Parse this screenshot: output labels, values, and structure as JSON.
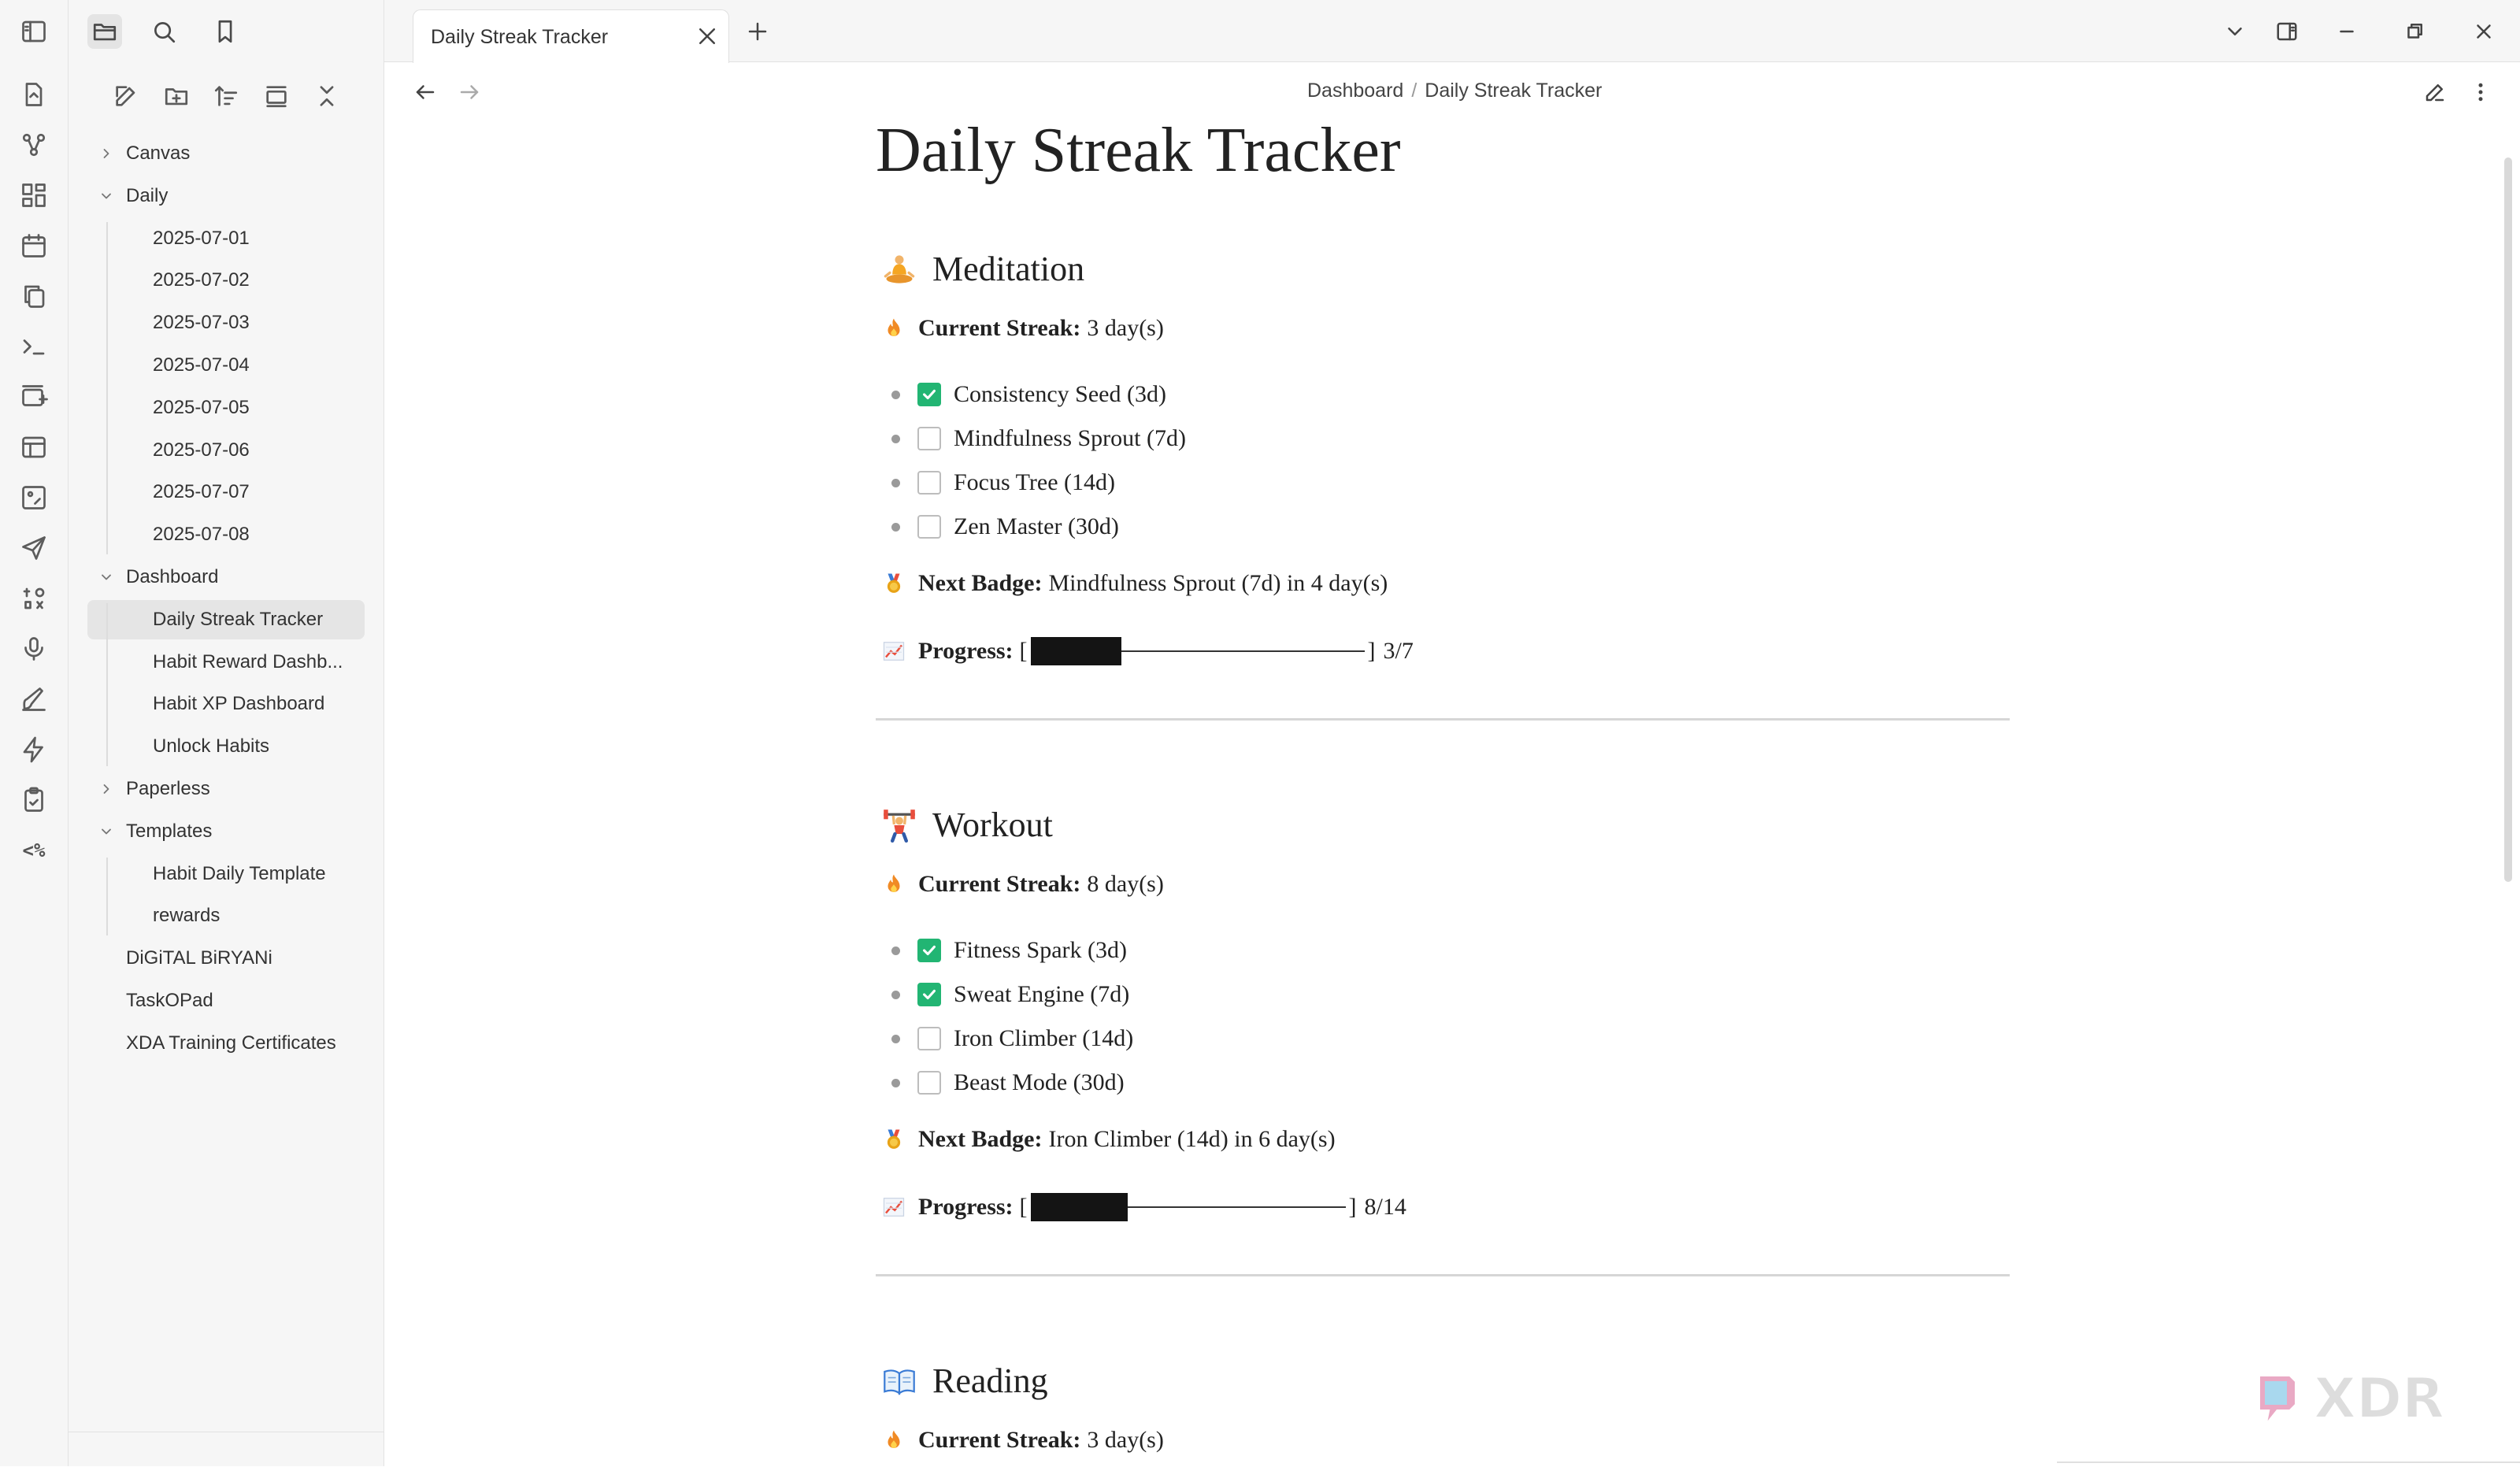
{
  "window": {
    "tab_title": "Daily Streak Tracker"
  },
  "breadcrumb": {
    "parent": "Dashboard",
    "separator": "/",
    "current": "Daily Streak Tracker"
  },
  "sidebar": {
    "tree": [
      {
        "label": "Canvas",
        "level": 0,
        "expandable": true,
        "expanded": false
      },
      {
        "label": "Daily",
        "level": 0,
        "expandable": true,
        "expanded": true
      },
      {
        "label": "2025-07-01",
        "level": 1
      },
      {
        "label": "2025-07-02",
        "level": 1
      },
      {
        "label": "2025-07-03",
        "level": 1
      },
      {
        "label": "2025-07-04",
        "level": 1
      },
      {
        "label": "2025-07-05",
        "level": 1
      },
      {
        "label": "2025-07-06",
        "level": 1
      },
      {
        "label": "2025-07-07",
        "level": 1
      },
      {
        "label": "2025-07-08",
        "level": 1
      },
      {
        "label": "Dashboard",
        "level": 0,
        "expandable": true,
        "expanded": true
      },
      {
        "label": "Daily Streak Tracker",
        "level": 1,
        "selected": true
      },
      {
        "label": "Habit Reward Dashb...",
        "level": 1
      },
      {
        "label": "Habit XP Dashboard",
        "level": 1
      },
      {
        "label": "Unlock Habits",
        "level": 1
      },
      {
        "label": "Paperless",
        "level": 0,
        "expandable": true,
        "expanded": false
      },
      {
        "label": "Templates",
        "level": 0,
        "expandable": true,
        "expanded": true
      },
      {
        "label": "Habit Daily Template",
        "level": 1
      },
      {
        "label": "rewards",
        "level": 1
      },
      {
        "label": "DiGiTAL BiRYANi",
        "level": 0
      },
      {
        "label": "TaskOPad",
        "level": 0
      },
      {
        "label": "XDA Training Certificates",
        "level": 0
      }
    ]
  },
  "ribbon_icons": [
    "sidebar-toggle-icon",
    "new-note-icon",
    "graph-icon",
    "dashboard-icon",
    "calendar-icon",
    "copy-icon",
    "terminal-icon",
    "card-add-icon",
    "table-icon",
    "image-icon",
    "send-icon",
    "hash-icon",
    "microphone-icon",
    "brush-icon",
    "lightning-icon",
    "clipboard-icon"
  ],
  "ribbon_text_icon": "<%",
  "note": {
    "title": "Daily Streak Tracker",
    "sections": [
      {
        "heading": "Meditation",
        "emoji": "meditation-icon",
        "streak_label": "Current Streak:",
        "streak_value": "3 day(s)",
        "badges": [
          {
            "label": "Consistency Seed (3d)",
            "done": true
          },
          {
            "label": "Mindfulness Sprout (7d)",
            "done": false
          },
          {
            "label": "Focus Tree (14d)",
            "done": false
          },
          {
            "label": "Zen Master (30d)",
            "done": false
          }
        ],
        "next_label": "Next Badge:",
        "next_value": "Mindfulness Sprout (7d) in 4 day(s)",
        "progress_label": "Progress:",
        "progress_done": 3,
        "progress_total": 7,
        "progress_text": "3/7"
      },
      {
        "heading": "Workout",
        "emoji": "weightlifting-icon",
        "streak_label": "Current Streak:",
        "streak_value": "8 day(s)",
        "badges": [
          {
            "label": "Fitness Spark (3d)",
            "done": true
          },
          {
            "label": "Sweat Engine (7d)",
            "done": true
          },
          {
            "label": "Iron Climber (14d)",
            "done": false
          },
          {
            "label": "Beast Mode (30d)",
            "done": false
          }
        ],
        "next_label": "Next Badge:",
        "next_value": "Iron Climber (14d) in 6 day(s)",
        "progress_label": "Progress:",
        "progress_done": 8,
        "progress_total": 14,
        "progress_text": "8/14"
      },
      {
        "heading": "Reading",
        "emoji": "book-icon",
        "streak_label": "Current Streak:",
        "streak_value": "3 day(s)"
      }
    ]
  },
  "watermark": "XDR",
  "colors": {
    "check_green": "#22b573",
    "bar_fill": "#141414",
    "fire": "#f08a24",
    "medal": "#e8a317"
  }
}
